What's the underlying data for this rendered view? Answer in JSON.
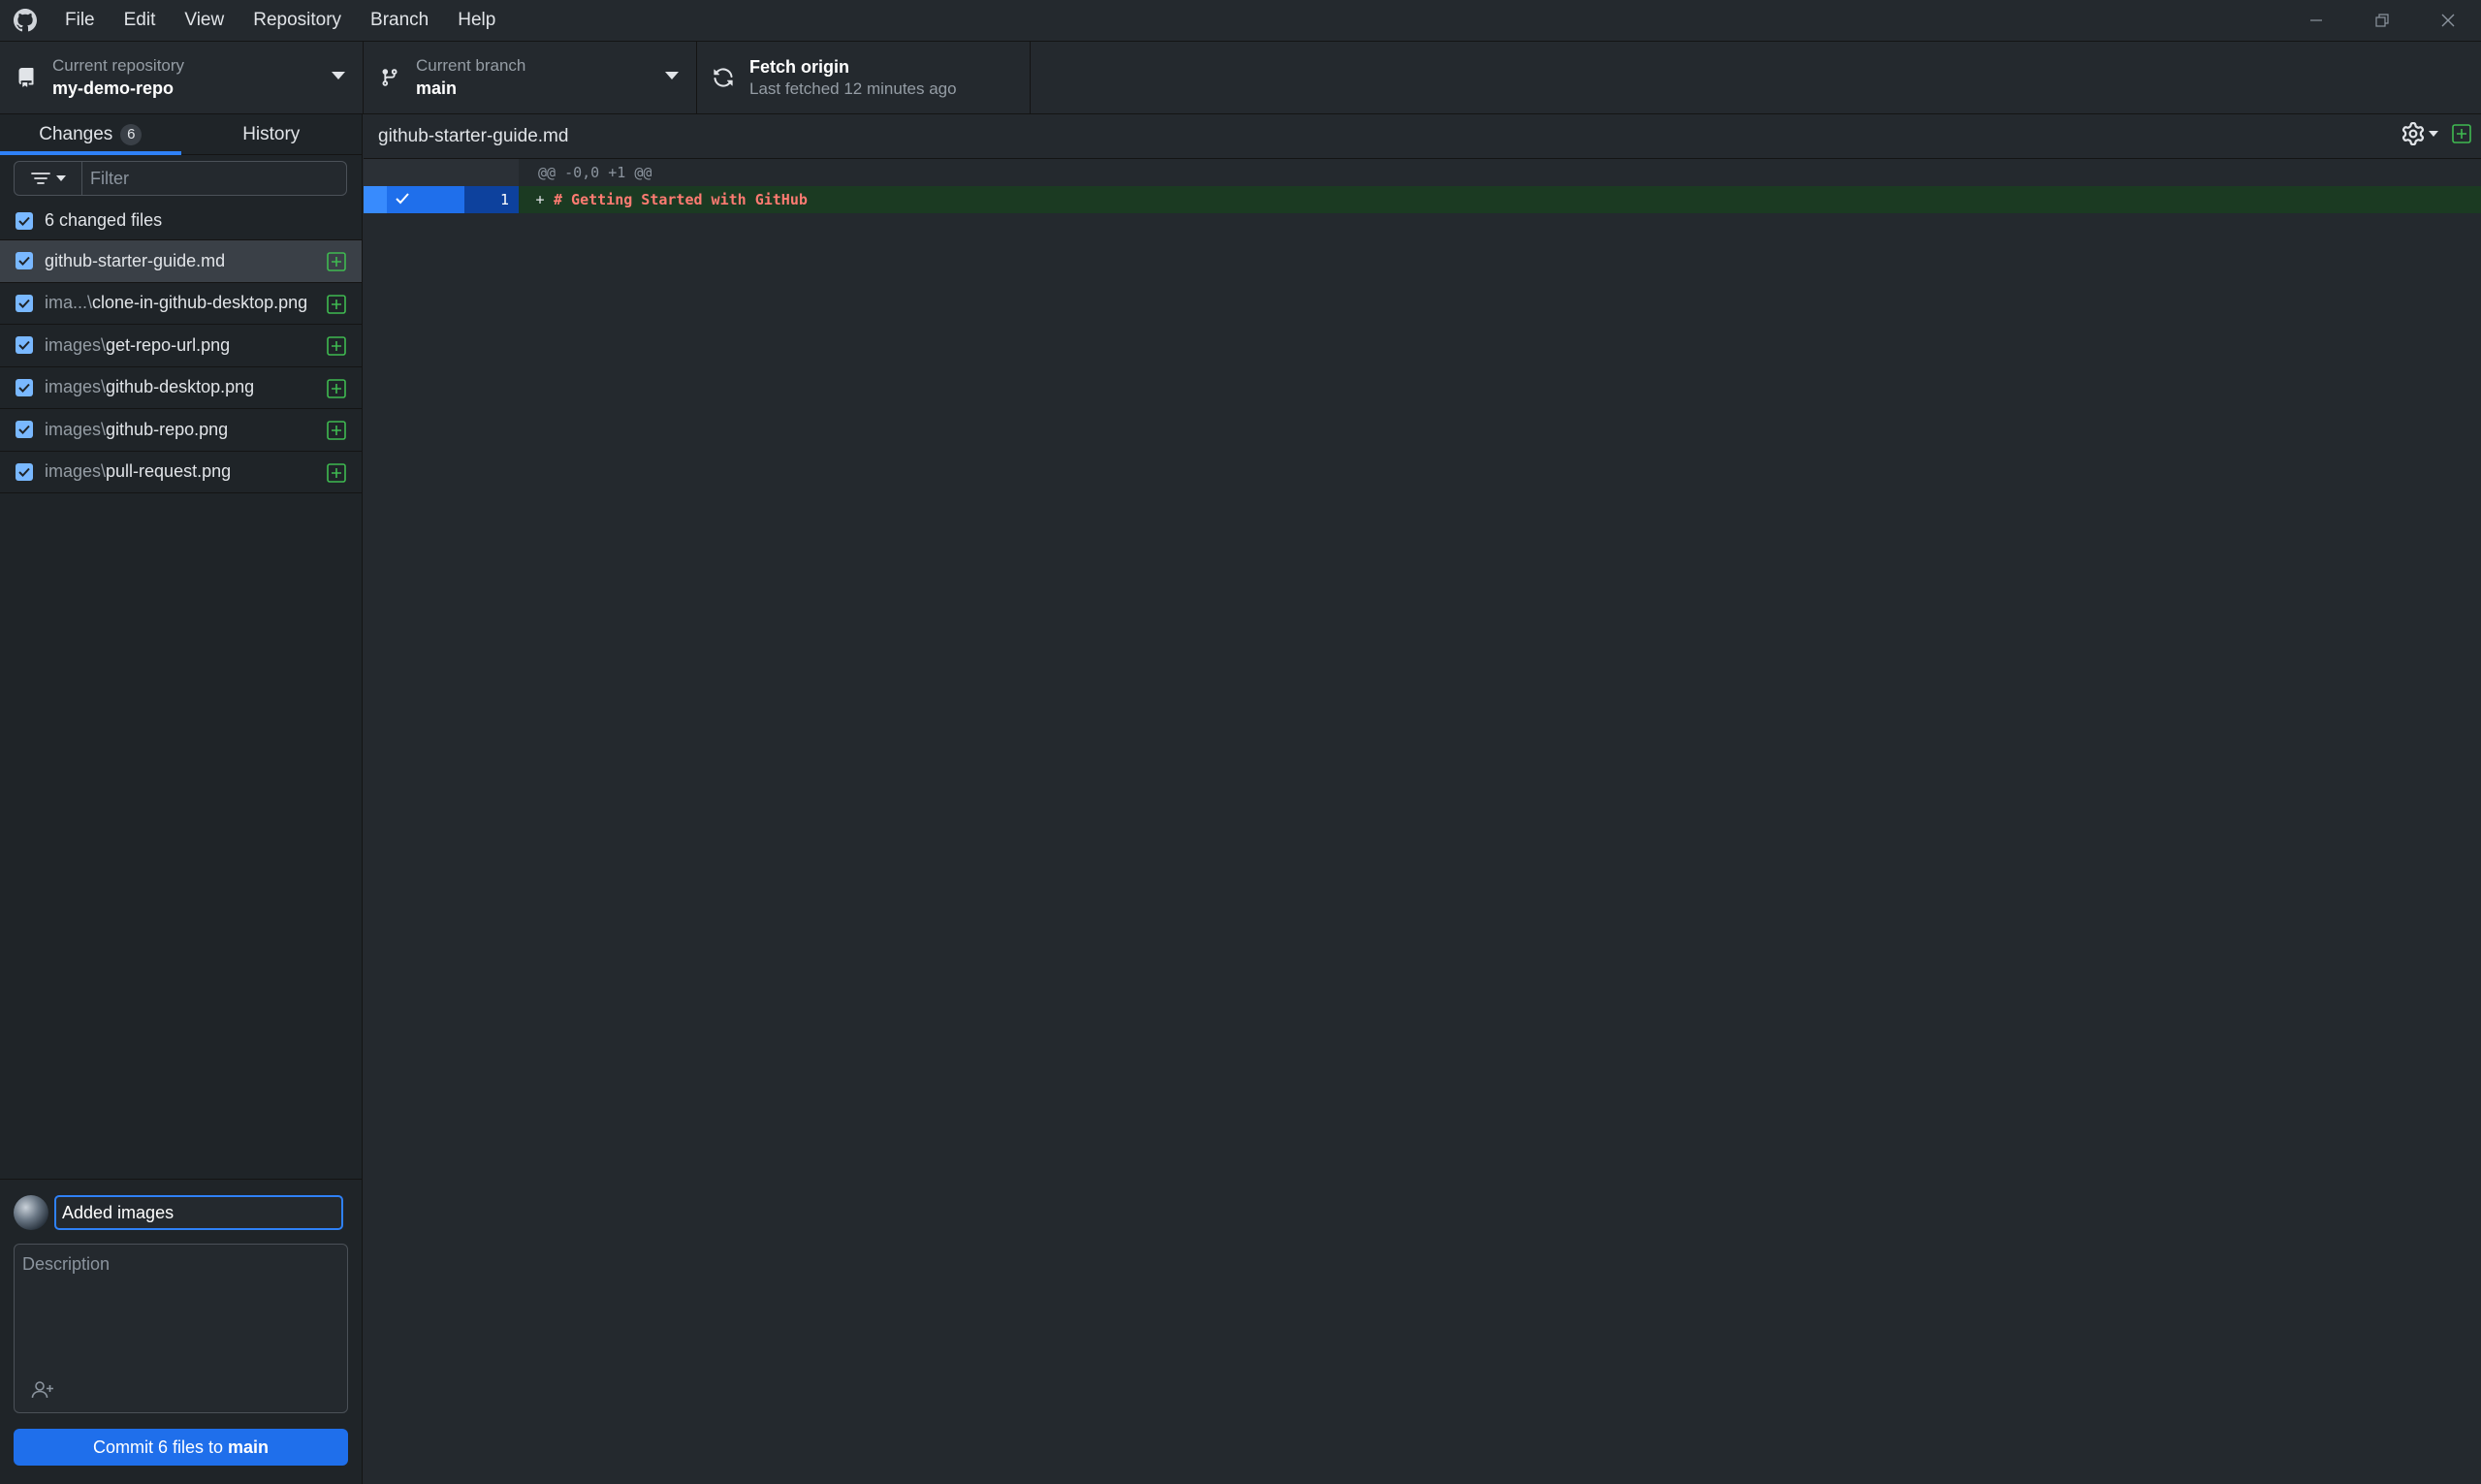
{
  "menu": {
    "items": [
      "File",
      "Edit",
      "View",
      "Repository",
      "Branch",
      "Help"
    ]
  },
  "toolbar": {
    "repo": {
      "label": "Current repository",
      "value": "my-demo-repo"
    },
    "branch": {
      "label": "Current branch",
      "value": "main"
    },
    "fetch": {
      "label": "Fetch origin",
      "subtitle": "Last fetched 12 minutes ago"
    }
  },
  "sidebar": {
    "tabs": {
      "changes": "Changes",
      "changes_count": "6",
      "history": "History"
    },
    "filter_placeholder": "Filter",
    "changed_files_label": "6 changed files",
    "files": [
      {
        "dir": "",
        "name": "github-starter-guide.md"
      },
      {
        "dir": "ima...\\",
        "name": "clone-in-github-desktop.png"
      },
      {
        "dir": "images\\",
        "name": "get-repo-url.png"
      },
      {
        "dir": "images\\",
        "name": "github-desktop.png"
      },
      {
        "dir": "images\\",
        "name": "github-repo.png"
      },
      {
        "dir": "images\\",
        "name": "pull-request.png"
      }
    ],
    "commit": {
      "summary_value": "Added images",
      "description_placeholder": "Description",
      "button_prefix": "Commit 6 files to",
      "button_branch": "main"
    }
  },
  "diff": {
    "filename": "github-starter-guide.md",
    "hunk_header": "@@ -0,0 +1 @@",
    "lines": [
      {
        "number": "1",
        "marker": "+",
        "code": "# Getting Started with GitHub"
      }
    ]
  },
  "colors": {
    "accent": "#1f6feb",
    "added_bg": "#1b3a22",
    "added_icon": "#3fb950",
    "added_code": "#ff7b72"
  }
}
